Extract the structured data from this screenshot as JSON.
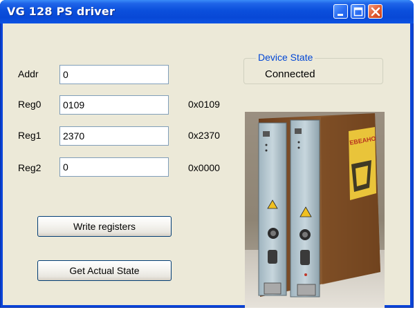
{
  "window": {
    "title": "VG 128 PS driver",
    "buttons": {
      "minimize": "minimize-icon",
      "maximize": "maximize-icon",
      "close": "close-icon"
    }
  },
  "form": {
    "addr": {
      "label": "Addr",
      "value": "0"
    },
    "reg0": {
      "label": "Reg0",
      "value": "0109",
      "hex": "0x0109"
    },
    "reg1": {
      "label": "Reg1",
      "value": "2370",
      "hex": "0x2370"
    },
    "reg2": {
      "label": "Reg2",
      "value": "0",
      "hex": "0x0000"
    }
  },
  "actions": {
    "write_label": "Write registers",
    "get_state_label": "Get Actual State"
  },
  "device_state": {
    "legend": "Device State",
    "value": "Connected"
  },
  "photo": {
    "warning_label": "ЕВЕАНО"
  },
  "colors": {
    "title_bar": "#0b4fdc",
    "client_bg": "#ece9d8",
    "group_legend": "#0046d5",
    "close_button": "#e15a2f"
  }
}
